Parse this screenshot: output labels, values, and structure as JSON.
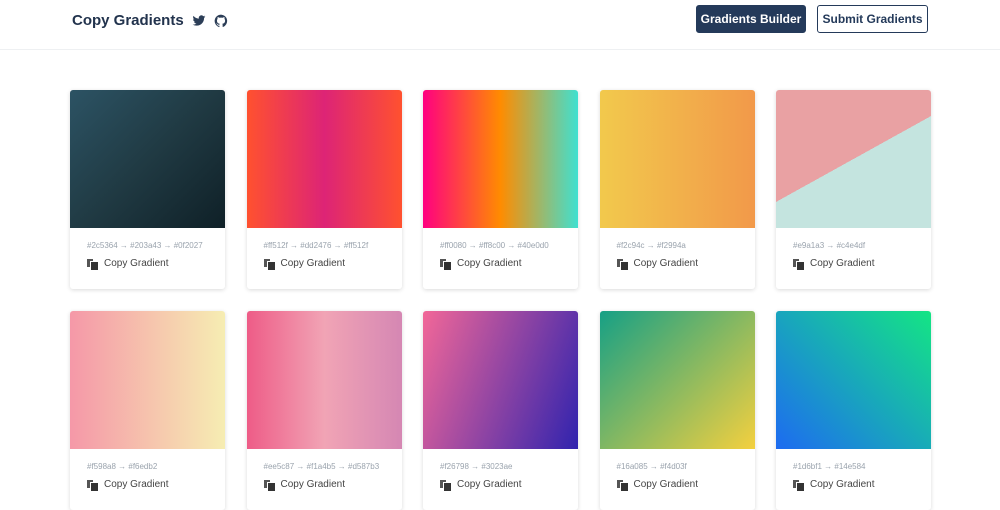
{
  "header": {
    "title": "Copy Gradients",
    "twitter_icon": "twitter-icon",
    "github_icon": "github-icon",
    "builder_label": "Gradients Builder",
    "submit_label": "Submit Gradients"
  },
  "gradients": [
    {
      "codes": "#2c5364 → #203a43 → #0f2027",
      "css": "linear-gradient(135deg,#2c5364,#203a43,#0f2027)",
      "copy": "Copy Gradient"
    },
    {
      "codes": "#ff512f → #dd2476 → #ff512f",
      "css": "linear-gradient(90deg,#ff512f,#dd2476,#ff512f)",
      "copy": "Copy Gradient"
    },
    {
      "codes": "#ff0080 → #ff8c00 → #40e0d0",
      "css": "linear-gradient(90deg,#ff0080,#ff8c00,#40e0d0)",
      "copy": "Copy Gradient"
    },
    {
      "codes": "#f2c94c → #f2994a",
      "css": "linear-gradient(90deg,#f2c94c,#f2994a)",
      "copy": "Copy Gradient"
    },
    {
      "codes": "#e9a1a3 → #c4e4df",
      "css": "linear-gradient(151deg,#e9a1a3 50%,#c4e4df 50%)",
      "copy": "Copy Gradient"
    },
    {
      "codes": "#f598a8 → #f6edb2",
      "css": "linear-gradient(90deg,#f598a8,#f6edb2)",
      "copy": "Copy Gradient"
    },
    {
      "codes": "#ee5c87 → #f1a4b5 → #d587b3",
      "css": "linear-gradient(90deg,#ee5c87,#f1a4b5,#d587b3)",
      "copy": "Copy Gradient"
    },
    {
      "codes": "#f26798 → #3023ae",
      "css": "linear-gradient(110deg,#f26798,#3023ae)",
      "copy": "Copy Gradient"
    },
    {
      "codes": "#16a085 → #f4d03f",
      "css": "linear-gradient(135deg,#16a085,#f4d03f)",
      "copy": "Copy Gradient"
    },
    {
      "codes": "#1d6bf1 → #14e584",
      "css": "linear-gradient(45deg,#1d6bf1,#14e584)",
      "copy": "Copy Gradient"
    }
  ]
}
